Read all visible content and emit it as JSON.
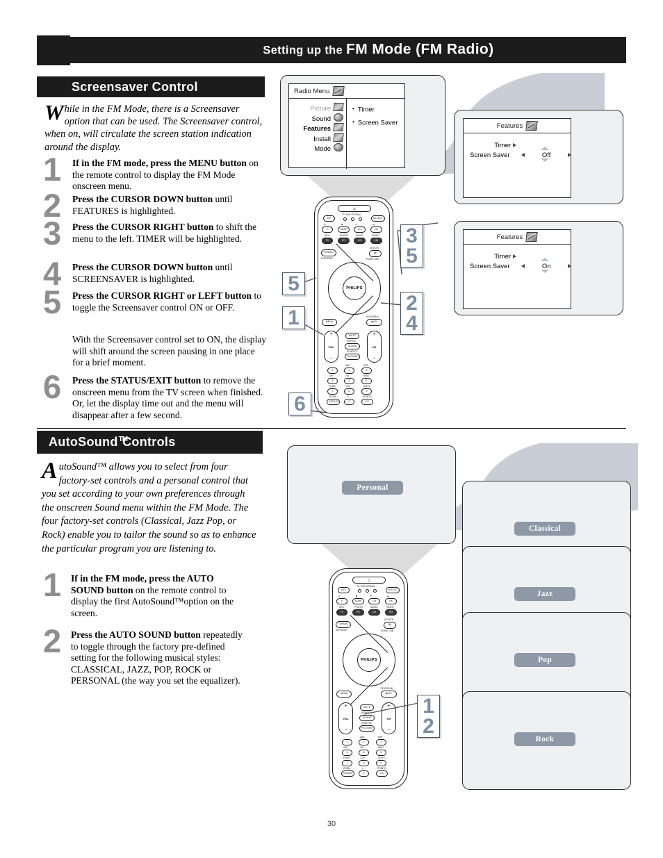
{
  "page": {
    "number": "30",
    "title_parts": {
      "pre": "Setting up the ",
      "fm": "FM Mode",
      " ": "",
      "paren": "(FM Radio)"
    },
    "title_full": "Setting up the FM Mode (FM Radio)",
    "header_icon": "music-note-icon"
  },
  "sections": {
    "screensaver": {
      "heading": "Screensaver Control",
      "intro_dropcap": "W",
      "intro_text": "hile in the FM Mode, there is a Screensaver option that can be used. The Screensaver control, when on, will circulate the screen station indication around the display.",
      "steps": [
        {
          "num": "1",
          "bold": "If in the FM mode, press the MENU button",
          "rest": " on the remote control to display the FM Mode onscreen menu."
        },
        {
          "num": "2",
          "bold": "Press the CURSOR DOWN button",
          "rest": " until FEATURES is highlighted."
        },
        {
          "num": "3",
          "bold": "Press the CURSOR RIGHT button",
          "rest": " to shift the menu to the left. TIMER will be highlighted."
        },
        {
          "num": "4",
          "bold": "Press the CURSOR DOWN button",
          "rest": " until SCREENSAVER is highlighted."
        },
        {
          "num": "5",
          "bold": "Press the CURSOR RIGHT or LEFT button",
          "rest": " to toggle the Screensaver control ON or OFF."
        },
        {
          "num": "6",
          "bold": "Press the STATUS/EXIT button",
          "rest": " to remove the onscreen menu from the TV screen when finished. Or, let the display time out and the menu will disappear after a few second."
        }
      ],
      "note": "With the Screensaver control set to ON, the display will shift around the screen pausing in one place for a brief moment."
    },
    "autosound": {
      "heading_main": "AutoSound",
      "heading_tm": "TM",
      "heading_rest": "Controls",
      "intro_dropcap": "A",
      "intro_text": "utoSound™ allows you to select from four factory-set controls and a personal control that you set according to your own preferences through the onscreen Sound menu within the FM Mode. The four factory-set controls (Classical, Jazz Pop, or Rock) enable you to tailor the sound so as to enhance the particular program you are listening to.",
      "steps": [
        {
          "num": "1",
          "bold": "If in the FM mode, press the AUTO SOUND button",
          "rest": " on the remote control to display the first AutoSound™option on the screen."
        },
        {
          "num": "2",
          "bold": "Press the AUTO SOUND button",
          "rest": " repeatedly to toggle through the factory pre-defined setting for the following musical styles: CLASSICAL, JAZZ, POP, ROCK or PERSONAL (the way you set the equalizer)."
        }
      ]
    }
  },
  "radio_menu": {
    "title": "Radio Menu",
    "left_items": [
      {
        "label": "Picture",
        "state": "disabled",
        "icon": "picture-icon"
      },
      {
        "label": "Sound",
        "state": "normal",
        "icon": "sound-icon"
      },
      {
        "label": "Features",
        "state": "active",
        "icon": "features-icon"
      },
      {
        "label": "Install",
        "state": "normal",
        "icon": "install-icon"
      },
      {
        "label": "Mode",
        "state": "normal",
        "icon": "mode-icon"
      }
    ],
    "right_items": [
      "Timer",
      "Screen Saver"
    ]
  },
  "features_screens": [
    {
      "title": "Features",
      "rows": [
        {
          "label": "Timer",
          "value": "",
          "arrow": "right"
        },
        {
          "label": "Screen Saver",
          "value": "Off",
          "arrow": "both"
        }
      ]
    },
    {
      "title": "Features",
      "rows": [
        {
          "label": "Timer",
          "value": "",
          "arrow": "right"
        },
        {
          "label": "Screen Saver",
          "value": "On",
          "arrow": "both"
        }
      ]
    }
  ],
  "autosound_screens": [
    {
      "label": "Personal"
    },
    {
      "label": "Classical"
    },
    {
      "label": "Jazz"
    },
    {
      "label": "Pop"
    },
    {
      "label": "Rock"
    }
  ],
  "callouts_top": [
    {
      "id": "callout-3-5",
      "lines": [
        "3",
        "5"
      ]
    },
    {
      "id": "callout-5",
      "lines": [
        "5"
      ]
    },
    {
      "id": "callout-2-4",
      "lines": [
        "2",
        "4"
      ]
    },
    {
      "id": "callout-1",
      "lines": [
        "1"
      ]
    },
    {
      "id": "callout-6",
      "lines": [
        "6"
      ]
    }
  ],
  "callouts_bottom": [
    {
      "id": "callout-1-2",
      "lines": [
        "1",
        "2"
      ]
    }
  ],
  "remote": {
    "brand": "PHILIPS",
    "top_labels": [
      "TV",
      "DVR",
      "STREAM"
    ],
    "buttons": {
      "av": "AV+",
      "select": "SELECT",
      "row2": [
        "F",
        "SURF",
        "CH",
        "OK"
      ],
      "row2_top": [
        "⏯",
        "■",
        "⏮",
        "⏭"
      ],
      "row3_top": [
        "REX",
        "PHOTO",
        "MUSIC",
        "VIDEO"
      ],
      "row3": [
        "TV",
        "PC",
        "CD",
        "HD"
      ],
      "format": "FORMAT",
      "internet": "INTERNET",
      "delete": "DELETE",
      "homelink": "HOME LINK",
      "menu": "MENU",
      "program": "PROGRAM",
      "ok": "OK",
      "mute": "MUTE",
      "repeat": "REPEAT",
      "sound": "SOUND",
      "shuffle": "SHUFFLE",
      "picture": "PICTURE",
      "vol": "VOL",
      "ch": "CH",
      "zoom": "ZOOM",
      "status": "STATUS",
      "points": "POINTS",
      "cc": "CC",
      "keys": [
        {
          "num": "1",
          "letters": "."
        },
        {
          "num": "2",
          "letters": "ABC"
        },
        {
          "num": "3",
          "letters": "DEF"
        },
        {
          "num": "4",
          "letters": "GHI"
        },
        {
          "num": "5",
          "letters": "JKL"
        },
        {
          "num": "6",
          "letters": "MNO"
        },
        {
          "num": "7",
          "letters": "PQRS"
        },
        {
          "num": "8",
          "letters": "TUV"
        },
        {
          "num": "9",
          "letters": "WXYZ"
        },
        {
          "num": "0",
          "letters": "⌘"
        }
      ]
    }
  },
  "colors": {
    "header_bg": "#1c1c1c",
    "step_number": "#8e8e8e",
    "callout_number": "#7b8fa3",
    "balloon": "#c9ced6",
    "screen_bg": "#eef0f1",
    "band_pill": "#8e98a6"
  }
}
